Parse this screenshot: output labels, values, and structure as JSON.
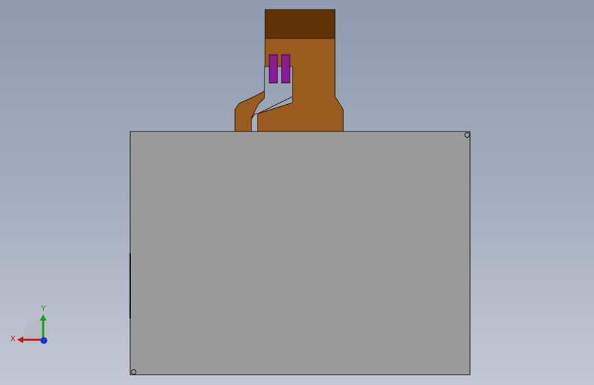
{
  "viewport": {
    "background_top": "#8e9bae",
    "background_bottom": "#c4c8d4"
  },
  "model": {
    "panel_color": "#9b9b9b",
    "flex_cable_color": "#9a5b1e",
    "connector_stiffener_color": "#5e3204",
    "component_color": "#8b1a96"
  },
  "triad": {
    "x_label": "X",
    "y_label": "Y",
    "x_color": "#c41818",
    "y_color": "#18a018",
    "z_color": "#1830d0"
  }
}
